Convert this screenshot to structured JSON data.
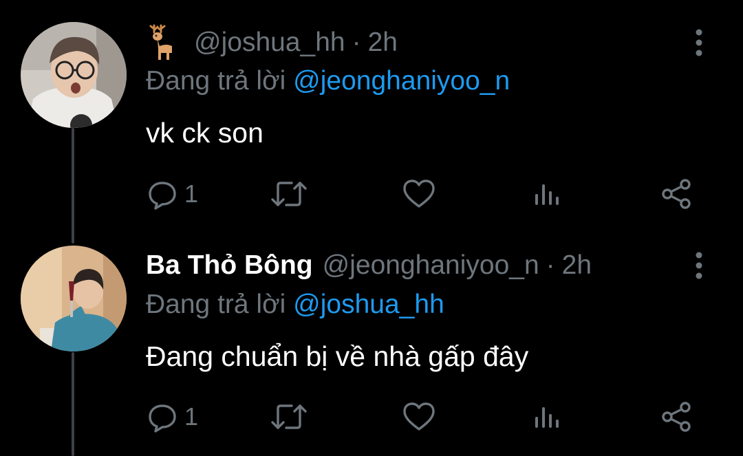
{
  "thread": [
    {
      "emoji": "deer",
      "display_name": "",
      "handle": "@joshua_hh",
      "separator": "·",
      "time": "2h",
      "reply_prefix": "Đang trả lời",
      "reply_to": "@jeonghaniyoo_n",
      "text": "vk ck son",
      "reply_count": "1"
    },
    {
      "display_name": "Ba Thỏ Bông",
      "handle": "@jeonghaniyoo_n",
      "separator": "·",
      "time": "2h",
      "reply_prefix": "Đang trả lời",
      "reply_to": "@joshua_hh",
      "text": "Đang chuẩn bị về nhà gấp đây",
      "reply_count": "1"
    }
  ],
  "icons": {
    "reply": "reply-icon",
    "retweet": "retweet-icon",
    "like": "like-icon",
    "analytics": "analytics-icon",
    "share": "share-icon",
    "more": "more-vertical-icon"
  },
  "colors": {
    "background": "#000000",
    "text": "#ffffff",
    "secondary": "#6e767d",
    "accent": "#1d9bf0",
    "thread_line": "#3d4147"
  }
}
